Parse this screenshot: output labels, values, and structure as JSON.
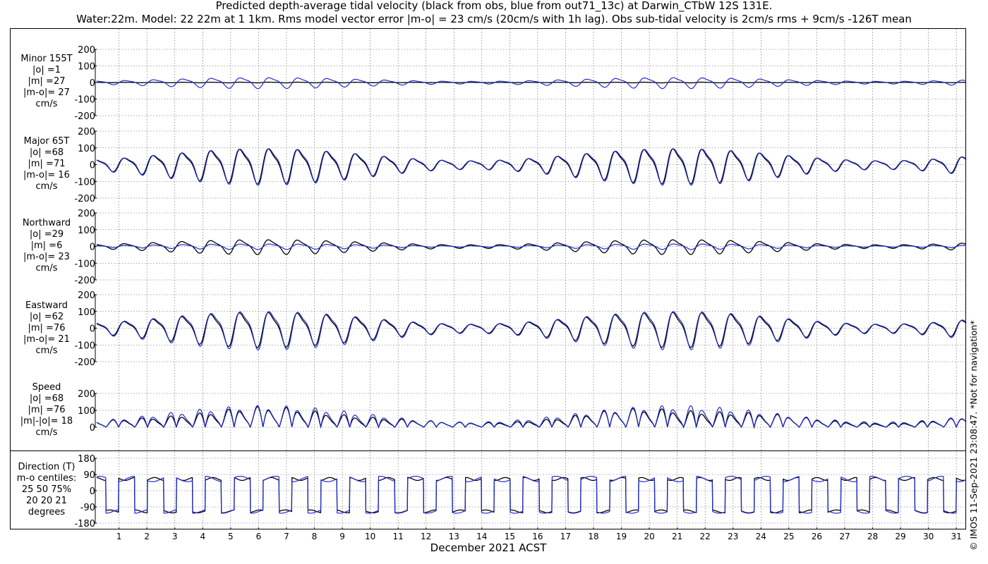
{
  "title": {
    "line1": "Predicted depth-average tidal velocity (black from obs, blue from out71_13c) at Darwin_CTbW 12S 131E.",
    "line2": "Water:22m. Model: 22 22m at 1 1km. Rms model vector error |m-o| = 23 cm/s (20cm/s with 1h lag). Obs sub-tidal velocity is 2cm/s rms + 9cm/s -126T mean"
  },
  "xlabel": "December 2021 ACST",
  "credit": "© IMOS 11-Sep-2021 23:08:47. *Not for navigation*",
  "colors": {
    "obs": "#000000",
    "model": "#1f2bd1",
    "grid": "#555555"
  },
  "panels": [
    {
      "id": "minor",
      "label": [
        "Minor 155T",
        "|o| =1",
        "|m| =27",
        "|m-o|= 27",
        "cm/s"
      ]
    },
    {
      "id": "major",
      "label": [
        "Major 65T",
        "|o| =68",
        "|m| =71",
        "|m-o|= 16",
        "cm/s"
      ]
    },
    {
      "id": "north",
      "label": [
        "Northward",
        "|o| =29",
        "|m| =6",
        "|m-o|= 23",
        "cm/s"
      ]
    },
    {
      "id": "east",
      "label": [
        "Eastward",
        "|o| =62",
        "|m| =76",
        "|m-o|= 21",
        "cm/s"
      ]
    },
    {
      "id": "speed",
      "label": [
        "Speed",
        "|o| =68",
        "|m| =76",
        "|m|-|o|= 18",
        "cm/s"
      ]
    },
    {
      "id": "dir",
      "label": [
        "Direction (T)",
        "m-o centiles:",
        "25  50  75%",
        "20  20  21",
        "degrees"
      ]
    }
  ],
  "chart_data": {
    "type": "line",
    "xlim": [
      0.2,
      31.35
    ],
    "x_ticks": [
      1,
      2,
      3,
      4,
      5,
      6,
      7,
      8,
      9,
      10,
      11,
      12,
      13,
      14,
      15,
      16,
      17,
      18,
      19,
      20,
      21,
      22,
      23,
      24,
      25,
      26,
      27,
      28,
      29,
      30,
      31
    ],
    "panels": [
      {
        "id": "minor",
        "ylim": [
          -200,
          200
        ],
        "yticks": [
          -200,
          -100,
          0,
          100,
          200
        ],
        "obs_amp": 2,
        "model_amp": 30
      },
      {
        "id": "major",
        "ylim": [
          -200,
          200
        ],
        "yticks": [
          -200,
          -100,
          0,
          100,
          200
        ],
        "obs_amp": 95,
        "model_amp": 100
      },
      {
        "id": "north",
        "ylim": [
          -200,
          200
        ],
        "yticks": [
          -200,
          -100,
          0,
          100,
          200
        ],
        "obs_amp": 40,
        "model_amp": 15
      },
      {
        "id": "east",
        "ylim": [
          -200,
          200
        ],
        "yticks": [
          -200,
          -100,
          0,
          100,
          200
        ],
        "obs_amp": 95,
        "model_amp": 105
      },
      {
        "id": "speed",
        "ylim": [
          0,
          200
        ],
        "yticks": [
          0,
          100,
          200
        ],
        "obs_amp": 100,
        "model_amp": 105
      },
      {
        "id": "dir",
        "ylim": [
          -180,
          180
        ],
        "yticks": [
          -180,
          -90,
          0,
          90,
          180
        ],
        "levels": [
          65,
          -115
        ]
      }
    ]
  }
}
